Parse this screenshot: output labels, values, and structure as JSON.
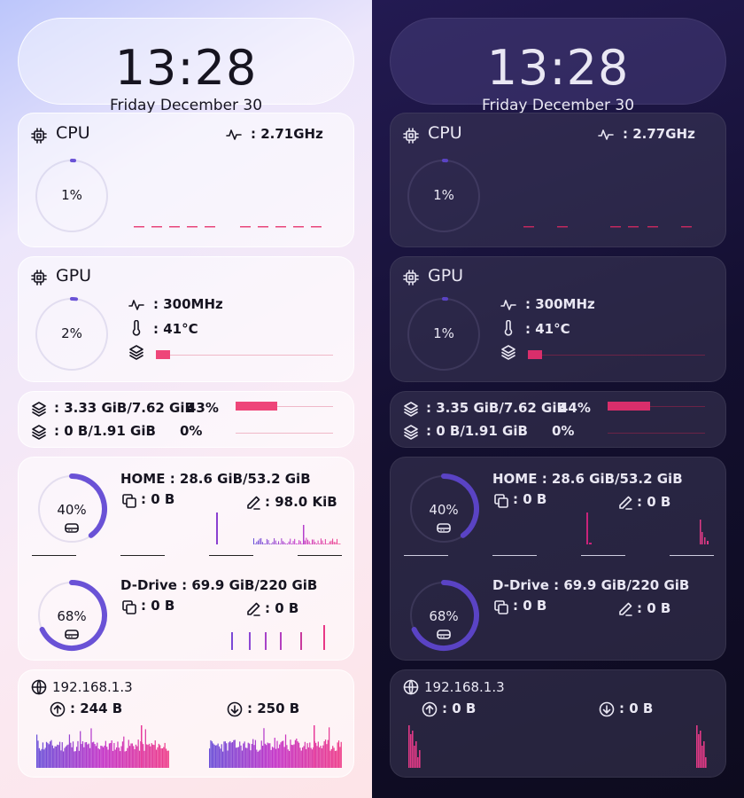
{
  "colors": {
    "accent_purple": "#6a4fd8",
    "accent_pink": "#ee3d8a",
    "light_bg": "#f5e9f5",
    "dark_bg": "#130f2f"
  },
  "light": {
    "clock": {
      "time": "13:28",
      "date": "Friday December 30"
    },
    "cpu": {
      "title": "CPU",
      "freq": ": 2.71GHz",
      "usage": "1%",
      "usage_value": 1,
      "icon": "chip-icon"
    },
    "gpu": {
      "title": "GPU",
      "usage": "2%",
      "usage_value": 2,
      "freq": ": 300MHz",
      "temp": ": 41°C",
      "mem_fraction": 0.08
    },
    "memory": {
      "ram": ": 3.33 GiB/7.62 GiB",
      "ram_pct": "43%",
      "ram_fraction": 0.43,
      "swap": ": 0 B/1.91 GiB",
      "swap_pct": "0%",
      "swap_fraction": 0
    },
    "disk1": {
      "label": "HOME : 28.6 GiB/53.2 GiB",
      "usage": "40%",
      "usage_value": 40,
      "read": ": 0 B",
      "write": ": 98.0 KiB"
    },
    "disk2": {
      "label": "D-Drive : 69.9 GiB/220 GiB",
      "usage": "68%",
      "usage_value": 68,
      "read": ": 0 B",
      "write": ": 0 B"
    },
    "network": {
      "ip": "192.168.1.3",
      "upload": ": 244 B",
      "download": ": 250 B"
    }
  },
  "dark": {
    "clock": {
      "time": "13:28",
      "date": "Friday December 30"
    },
    "cpu": {
      "title": "CPU",
      "freq": ": 2.77GHz",
      "usage": "1%",
      "usage_value": 1,
      "icon": "chip-icon"
    },
    "gpu": {
      "title": "GPU",
      "usage": "1%",
      "usage_value": 1,
      "freq": ": 300MHz",
      "temp": ": 41°C",
      "mem_fraction": 0.08
    },
    "memory": {
      "ram": ": 3.35 GiB/7.62 GiB",
      "ram_pct": "44%",
      "ram_fraction": 0.44,
      "swap": ": 0 B/1.91 GiB",
      "swap_pct": "0%",
      "swap_fraction": 0
    },
    "disk1": {
      "label": "HOME : 28.6 GiB/53.2 GiB",
      "usage": "40%",
      "usage_value": 40,
      "read": ": 0 B",
      "write": ": 0 B"
    },
    "disk2": {
      "label": "D-Drive : 69.9 GiB/220 GiB",
      "usage": "68%",
      "usage_value": 68,
      "read": ": 0 B",
      "write": ": 0 B"
    },
    "network": {
      "ip": "192.168.1.3",
      "upload": ": 0 B",
      "download": ": 0 B"
    }
  }
}
